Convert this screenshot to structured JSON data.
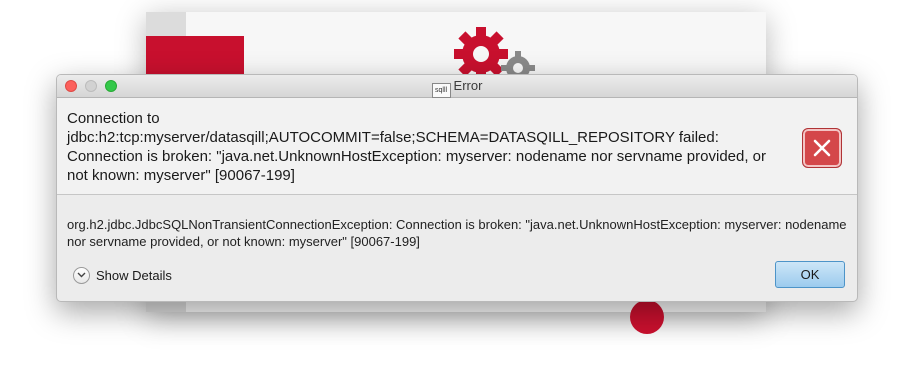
{
  "background_app": {
    "accent_color": "#c8102e",
    "logo_icon": "gear-icon"
  },
  "dialog": {
    "title": "Error",
    "app_icon_text": "sqlll",
    "header_message": "Connection to jdbc:h2:tcp:myserver/datasqill;AUTOCOMMIT=false;SCHEMA=DATASQILL_REPOSITORY failed: Connection is broken: \"java.net.UnknownHostException: myserver: nodename nor servname provided, or not known: myserver\" [90067-199]",
    "content_message": "org.h2.jdbc.JdbcSQLNonTransientConnectionException: Connection is broken: \"java.net.UnknownHostException: myserver: nodename nor servname provided, or not known: myserver\" [90067-199]",
    "details_label": "Show Details",
    "ok_label": "OK",
    "error_icon": "error-x-icon",
    "error_color": "#d4474a"
  }
}
